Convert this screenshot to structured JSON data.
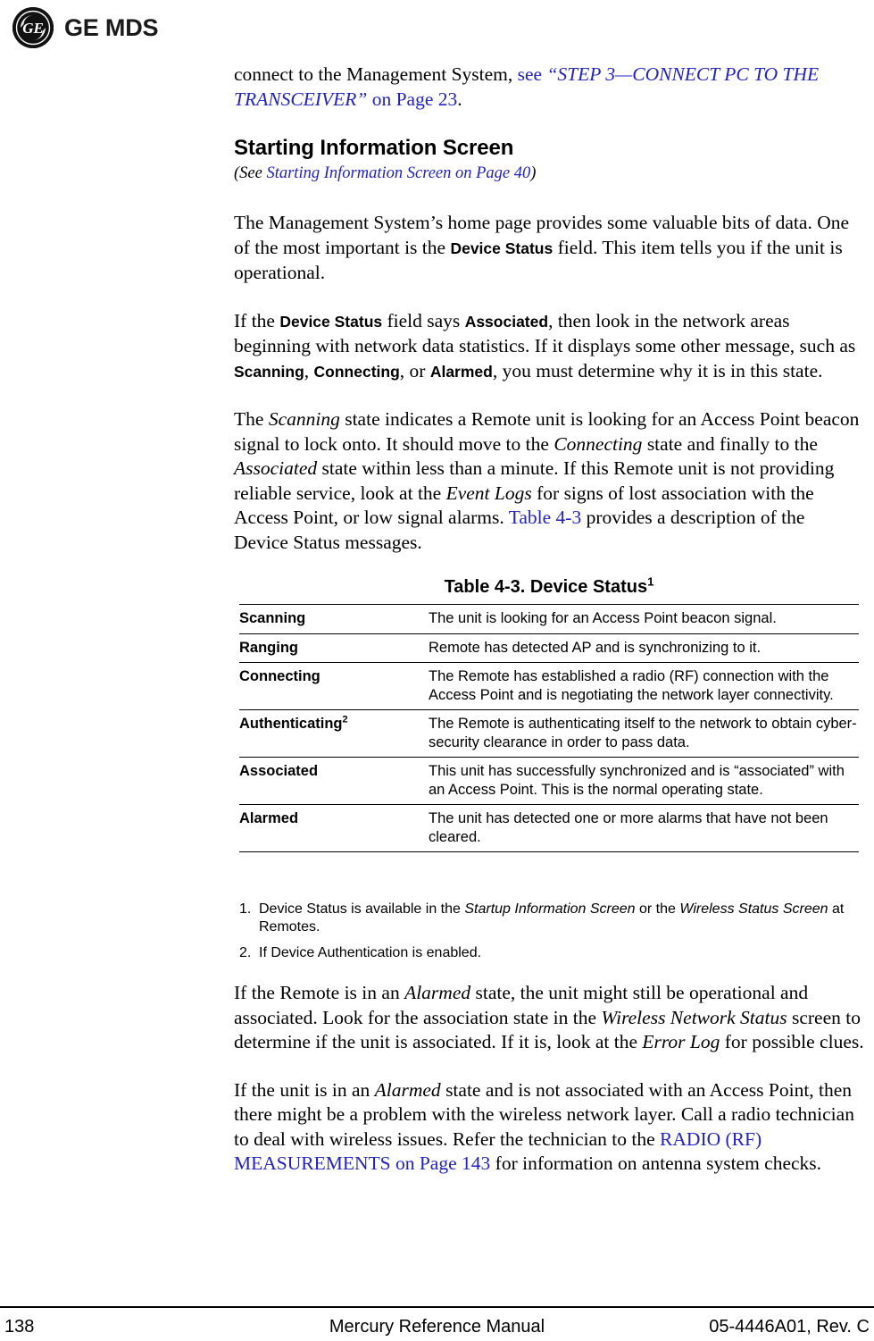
{
  "logo": {
    "monogram_alt": "GE monogram",
    "wordmark": "GE MDS"
  },
  "intro": {
    "line_a": "connect to the Management System, ",
    "link_lead": "see ",
    "link_title": "“STEP 3—CONNECT PC TO THE TRANSCEIVER”",
    "link_page": " on Page 23",
    "trailing": "."
  },
  "section": {
    "heading": "Starting Information Screen",
    "subref_open": "(See ",
    "subref_link": "Starting Information Screen on Page 40",
    "subref_close": ")"
  },
  "paragraphs": {
    "p1_a": "The Management System’s home page provides some valuable bits of data. One of the most important is the ",
    "p1_term1": "Device Status",
    "p1_b": " field. This item tells you if the unit is operational.",
    "p2_a": "If the ",
    "p2_term1": "Device Status",
    "p2_b": " field says ",
    "p2_term2": "Associated",
    "p2_c": ", then look in the network areas beginning with network data statistics. If it displays some other message, such as ",
    "p2_term3": "Scanning",
    "p2_d": ", ",
    "p2_term4": "Connecting",
    "p2_e": ", or ",
    "p2_term5": "Alarmed",
    "p2_f": ", you must determine why it is in this state.",
    "p3_a": "The ",
    "p3_i1": "Scanning",
    "p3_b": " state indicates a Remote unit is looking for an Access Point beacon signal to lock onto. It should move to the ",
    "p3_i2": "Connecting",
    "p3_c": " state and finally to the ",
    "p3_i3": "Associated",
    "p3_d": " state within less than a minute. If this Remote unit is not providing reliable service, look at the ",
    "p3_i4": "Event Logs",
    "p3_e": " for signs of lost association with the Access Point, or low signal alarms. ",
    "p3_link": "Table 4-3",
    "p3_f": " provides a description of the Device Status messages.",
    "p4_a": "If the Remote is in an ",
    "p4_i1": "Alarmed",
    "p4_b": " state, the unit might still be operational and associated. Look for the association state in the ",
    "p4_i2": "Wireless Network Status",
    "p4_c": " screen to determine if the unit is associated. If it is, look at the ",
    "p4_i3": "Error Log",
    "p4_d": " for possible clues.",
    "p5_a": "If the unit is in an ",
    "p5_i1": "Alarmed",
    "p5_b": " state and is not associated with an Access Point, then there might be a problem with the wireless network layer. Call a radio technician to deal with wireless issues. Refer the technician to the ",
    "p5_link": "RADIO (RF) MEASUREMENTS on Page 143",
    "p5_c": " for information on antenna system checks."
  },
  "table": {
    "caption_text": "Table 4-3. Device Status",
    "caption_sup": "1",
    "rows": [
      {
        "state": "Scanning",
        "state_sup": "",
        "description": "The unit is looking for an Access Point beacon signal."
      },
      {
        "state": "Ranging",
        "state_sup": "",
        "description": "Remote has detected AP and is synchronizing to it."
      },
      {
        "state": "Connecting",
        "state_sup": "",
        "description": "The Remote has established a radio (RF) connection with the Access Point and is negotiating the network layer connectivity."
      },
      {
        "state": "Authenticating",
        "state_sup": "2",
        "description": "The Remote is authenticating itself to the network to obtain cyber-security clearance in order to pass data."
      },
      {
        "state": "Associated",
        "state_sup": "",
        "description": "This unit has successfully synchronized and is “associated” with an Access Point. This is the normal operating state."
      },
      {
        "state": "Alarmed",
        "state_sup": "",
        "description": "The unit has detected one or more alarms that have not been cleared."
      }
    ]
  },
  "footnotes": [
    {
      "num": "1.",
      "a": "Device Status is available in the ",
      "i1": "Startup Information Screen",
      "b": " or the ",
      "i2": "Wireless Status Screen",
      "c": " at Remotes."
    },
    {
      "num": "2.",
      "a": "If Device Authentication is enabled.",
      "i1": "",
      "b": "",
      "i2": "",
      "c": ""
    }
  ],
  "footer": {
    "page_number": "138",
    "manual_title": "Mercury Reference Manual",
    "doc_number": "05-4446A01, Rev. C"
  },
  "colors": {
    "link_blue": "#2222c4",
    "text_black": "#000000",
    "rule_black": "#000000"
  }
}
